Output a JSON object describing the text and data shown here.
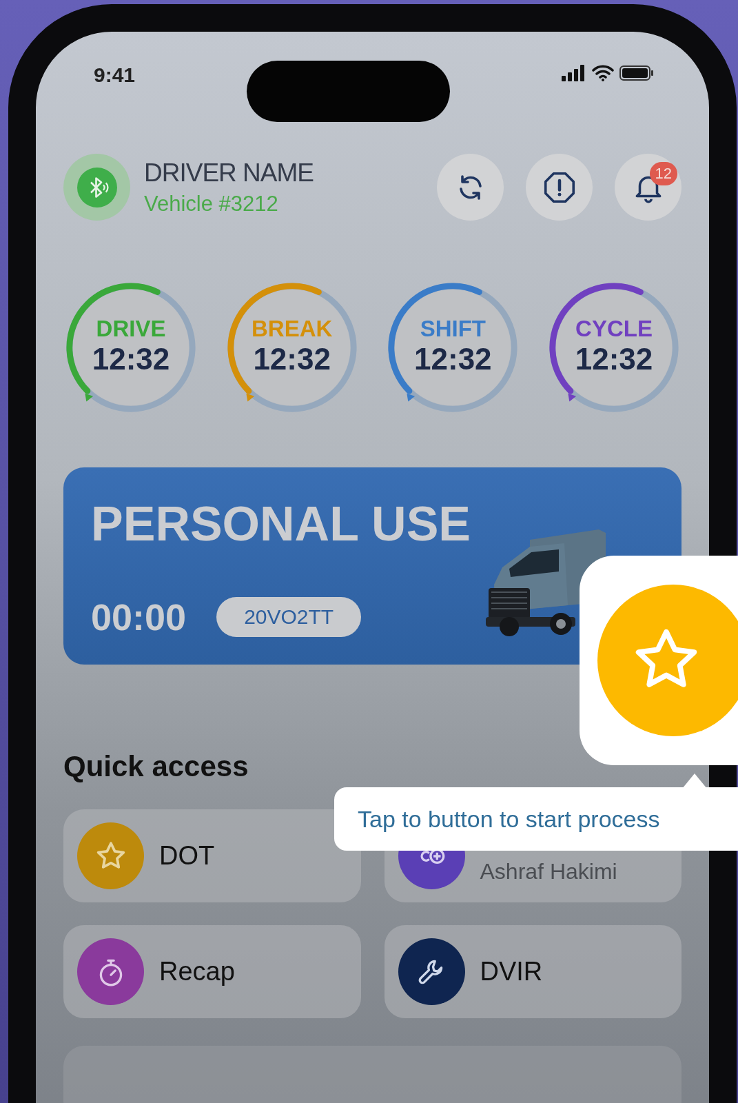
{
  "status_bar": {
    "time": "9:41"
  },
  "driver": {
    "name": "DRIVER NAME",
    "vehicle": "Vehicle #3212"
  },
  "notifications": {
    "count": "12"
  },
  "timers": [
    {
      "label": "DRIVE",
      "value": "12:32",
      "color": "#3aa83a",
      "level": 0.45
    },
    {
      "label": "BREAK",
      "value": "12:32",
      "color": "#d4900a",
      "level": 0.45
    },
    {
      "label": "SHIFT",
      "value": "12:32",
      "color": "#3a7cc8",
      "level": 0.45
    },
    {
      "label": "CYCLE",
      "value": "12:32",
      "color": "#7040c0",
      "level": 0.45
    }
  ],
  "status_card": {
    "title": "PERSONAL USE",
    "timer": "00:00",
    "code": "20VO2TT"
  },
  "quick_access": {
    "title": "Quick access",
    "items": [
      {
        "kind": "action",
        "label": "DOT",
        "color": "#bd8a0c"
      },
      {
        "kind": "contact",
        "label": "Ashraf Hakimi",
        "color": "#5a3fb5"
      },
      {
        "kind": "action",
        "label": "Recap",
        "color": "#8a3a9c"
      },
      {
        "kind": "action",
        "label": "DVIR",
        "color": "#0f2550"
      }
    ]
  },
  "tooltip": {
    "text": "Tap to button to start process"
  }
}
